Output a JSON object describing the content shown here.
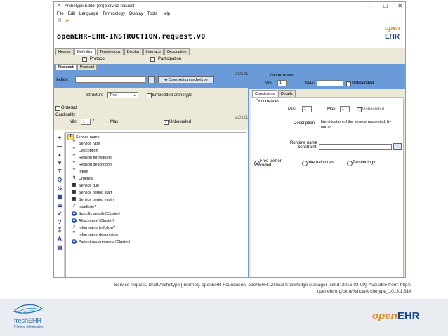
{
  "window": {
    "title": "Archetype Editor [en] Service request",
    "controls": [
      "—",
      "☐",
      "✕"
    ]
  },
  "menu": [
    "File",
    "Edit",
    "Language",
    "Terminology",
    "Display",
    "Tools",
    "Help"
  ],
  "toolbar": {
    "new_icon": "new-file-icon",
    "open_icon": "open-folder-icon"
  },
  "header": {
    "concept_id": "openEHR-EHR-INSTRUCTION.request.v0",
    "logo_top": "open",
    "logo_bottom": "EHR"
  },
  "main_tabs": [
    "Header",
    "Definition",
    "Terminology",
    "Display",
    "Interface",
    "Description"
  ],
  "sections": {
    "protocol": "Protocol",
    "participation": "Participation"
  },
  "sub_tabs": [
    "Request",
    "Protocol"
  ],
  "action": {
    "label": "Action",
    "value": "",
    "open_button": "Open Action archetype",
    "id": "at0121"
  },
  "structure": {
    "label": "Structure",
    "value": "Tree",
    "embedded_label": "Embedded archetype",
    "ordered_label": "Ordered",
    "cardinality_label": "Cardinality",
    "min_label": "Min:",
    "min_value": "1",
    "max_label": "Max",
    "unbounded_label": "Unbounded",
    "node_id": "at0121"
  },
  "occurrences": {
    "title": "Occurrences",
    "min_label": "Min:",
    "min_value": "1",
    "max_label": "Max:",
    "unbounded_label": "Unbounded"
  },
  "tree_nodes": [
    {
      "label": "Service name",
      "icon": "T",
      "kind": "text",
      "selected": true
    },
    {
      "label": "Service type",
      "icon": "T",
      "kind": "text"
    },
    {
      "label": "Description",
      "icon": "T",
      "kind": "text"
    },
    {
      "label": "Reason for request",
      "icon": "T",
      "kind": "text"
    },
    {
      "label": "Reason description",
      "icon": "T",
      "kind": "text"
    },
    {
      "label": "Intent",
      "icon": "T",
      "kind": "text"
    },
    {
      "label": "Urgency",
      "icon": "↯",
      "kind": "ordinal"
    },
    {
      "label": "Service due",
      "icon": "▦",
      "kind": "datetime"
    },
    {
      "label": "Service period start",
      "icon": "▦",
      "kind": "datetime"
    },
    {
      "label": "Service period expiry",
      "icon": "▦",
      "kind": "datetime"
    },
    {
      "label": "Indefinite?",
      "icon": "✓",
      "kind": "boolean"
    },
    {
      "label": "Specific details [Cluster]",
      "icon": "A",
      "kind": "slot"
    },
    {
      "label": "Attachment [Cluster]",
      "icon": "A",
      "kind": "slot"
    },
    {
      "label": "Information to follow?",
      "icon": "✓",
      "kind": "boolean"
    },
    {
      "label": "Information description",
      "icon": "T",
      "kind": "text"
    },
    {
      "label": "Patient requirements [Cluster]",
      "icon": "A",
      "kind": "slot"
    }
  ],
  "left_toolbar": [
    "+",
    "—",
    "▲",
    "▼",
    "T",
    "Q",
    "½",
    "▦",
    "☰",
    "✓",
    "?",
    "⁑",
    "A",
    "▤"
  ],
  "constraints": {
    "tabs": [
      "Constraints",
      "Details"
    ],
    "occurrences_label": "Occurrences",
    "min_label": "Min:",
    "min_value": "1",
    "max_label": "Max:",
    "max_value": "1",
    "unbounded_label": "Unbounded",
    "description_label": "Description:",
    "description_value": "Identification of the service requested, by name.",
    "runtime_label": "Runtime name constraint:",
    "runtime_button": "...",
    "free_text_label": "Free text or coded",
    "internal_label": "Internal codes",
    "terminology_label": "Terminology"
  },
  "caption": {
    "line1": "Service request, Draft Archetype [Internet]. openEHR Foundation, openEHR Clinical Knowledge Manager [cited: 2016-03-09]. Available from: http://",
    "line2": "openehr.org/ckm/#showArchetype_1013.1.614"
  },
  "footer": {
    "fresh_name": "freshEHR",
    "fresh_tagline": "Clinical informatics",
    "brand_open": "open",
    "brand_ehr": "EHR"
  },
  "colors": {
    "panel_blue": "#6a9ad8",
    "brand_orange": "#e08a1e",
    "brand_blue": "#1a4a8a"
  }
}
